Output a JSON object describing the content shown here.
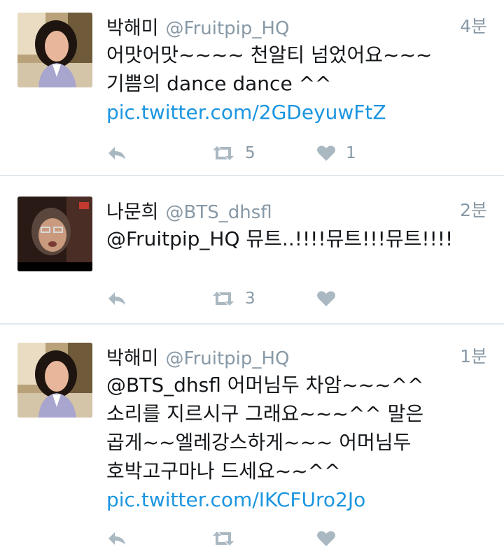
{
  "tweets": [
    {
      "name": "박해미",
      "handle": "@Fruitpip_HQ",
      "time": "4분",
      "lines": [
        "어맛어맛~~~~ 천알티 넘었어요~~~",
        "기쁨의 dance dance ^^"
      ],
      "link": "pic.twitter.com/2GDeyuwFtZ",
      "retweets": "5",
      "likes": "1",
      "icons": {
        "reply": "reply-icon",
        "retweet": "retweet-icon",
        "like": "heart-icon"
      }
    },
    {
      "name": "나문희",
      "handle": "@BTS_dhsfl",
      "time": "2분",
      "lines": [
        "@Fruitpip_HQ 뮤트..!!!!뮤트!!!뮤트!!!!"
      ],
      "link": "",
      "retweets": "3",
      "likes": "",
      "icons": {
        "reply": "reply-icon",
        "retweet": "retweet-icon",
        "like": "heart-icon"
      }
    },
    {
      "name": "박해미",
      "handle": "@Fruitpip_HQ",
      "time": "1분",
      "lines": [
        "@BTS_dhsfl 어머님두 차암~~~^^",
        "소리를 지르시구 그래요~~~^^ 말은",
        "곱게~~엘레강스하게~~~ 어머님두",
        "호박고구마나 드세요~~^^"
      ],
      "link": "pic.twitter.com/IKCFUro2Jo",
      "retweets": "",
      "likes": "",
      "icons": {
        "reply": "reply-icon",
        "retweet": "retweet-icon",
        "like": "heart-icon"
      }
    }
  ],
  "colors": {
    "link": "#1b95e0",
    "meta": "#8899a6",
    "icon": "#aab8c2",
    "divider": "#e1e8ed"
  }
}
